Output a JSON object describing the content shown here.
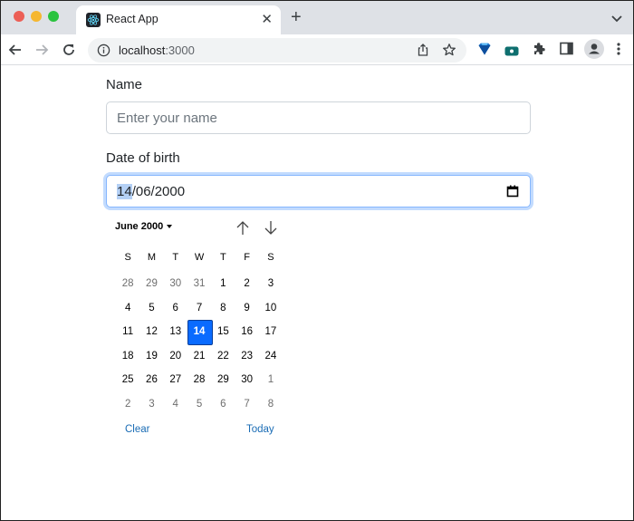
{
  "browser": {
    "tab": {
      "title": "React App",
      "favicon": "react-logo-icon"
    },
    "new_tab_symbol": "+",
    "close_symbol": "✕",
    "url_host": "localhost",
    "url_port": ":3000",
    "extensions": [
      "gem-extension-icon",
      "screen-recorder-extension-icon",
      "puzzle-extensions-icon",
      "side-panel-icon",
      "profile-avatar-icon",
      "more-menu-icon"
    ]
  },
  "form": {
    "name": {
      "label": "Name",
      "placeholder": "Enter your name",
      "value": ""
    },
    "dob": {
      "label": "Date of birth",
      "value_day": "14",
      "value_rest": "/06/2000"
    }
  },
  "datepicker": {
    "month_label": "June 2000",
    "weekdays": [
      "S",
      "M",
      "T",
      "W",
      "T",
      "F",
      "S"
    ],
    "days": [
      {
        "d": "28",
        "other": true
      },
      {
        "d": "29",
        "other": true
      },
      {
        "d": "30",
        "other": true
      },
      {
        "d": "31",
        "other": true
      },
      {
        "d": "1"
      },
      {
        "d": "2"
      },
      {
        "d": "3"
      },
      {
        "d": "4"
      },
      {
        "d": "5"
      },
      {
        "d": "6"
      },
      {
        "d": "7"
      },
      {
        "d": "8"
      },
      {
        "d": "9"
      },
      {
        "d": "10"
      },
      {
        "d": "11"
      },
      {
        "d": "12"
      },
      {
        "d": "13"
      },
      {
        "d": "14",
        "selected": true
      },
      {
        "d": "15"
      },
      {
        "d": "16"
      },
      {
        "d": "17"
      },
      {
        "d": "18"
      },
      {
        "d": "19"
      },
      {
        "d": "20"
      },
      {
        "d": "21"
      },
      {
        "d": "22"
      },
      {
        "d": "23"
      },
      {
        "d": "24"
      },
      {
        "d": "25"
      },
      {
        "d": "26"
      },
      {
        "d": "27"
      },
      {
        "d": "28"
      },
      {
        "d": "29"
      },
      {
        "d": "30"
      },
      {
        "d": "1",
        "other": true
      },
      {
        "d": "2",
        "other": true
      },
      {
        "d": "3",
        "other": true
      },
      {
        "d": "4",
        "other": true
      },
      {
        "d": "5",
        "other": true
      },
      {
        "d": "6",
        "other": true
      },
      {
        "d": "7",
        "other": true
      },
      {
        "d": "8",
        "other": true
      }
    ],
    "clear_label": "Clear",
    "today_label": "Today"
  },
  "colors": {
    "accent": "#0a6bff",
    "link": "#1a6cb5",
    "focus_ring": "#86b7fe"
  }
}
